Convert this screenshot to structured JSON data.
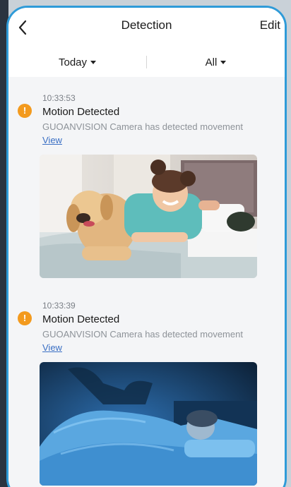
{
  "header": {
    "title": "Detection",
    "edit_label": "Edit",
    "back_icon": "chevron-left-icon"
  },
  "filters": {
    "date": "Today",
    "type": "All"
  },
  "events": [
    {
      "time": "10:33:53",
      "title": "Motion Detected",
      "description": "GUOANVISION Camera has detected movement",
      "link": "View",
      "icon": "alert-icon"
    },
    {
      "time": "10:33:39",
      "title": "Motion Detected",
      "description": "GUOANVISION Camera has detected movement",
      "link": "View",
      "icon": "alert-icon"
    }
  ],
  "colors": {
    "accent_border": "#2f9bd8",
    "alert": "#f39a1e",
    "link": "#3a6fc4"
  }
}
